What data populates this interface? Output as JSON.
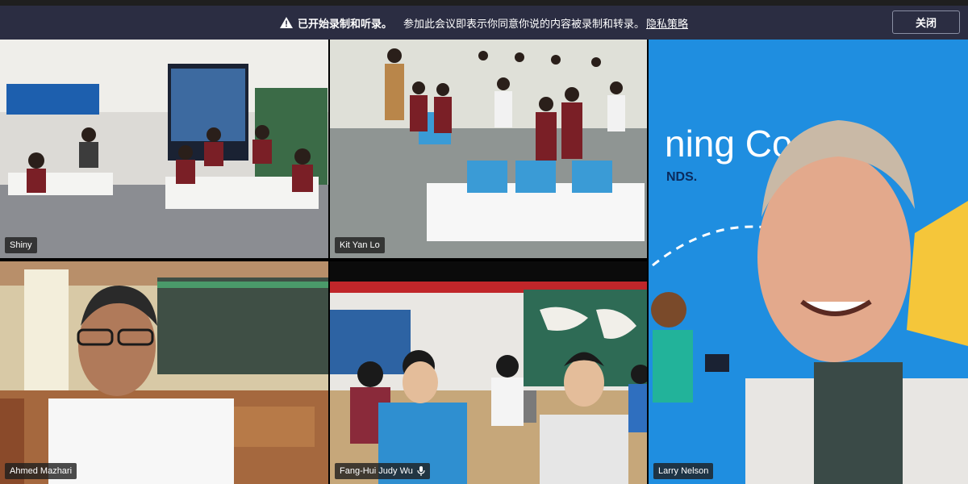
{
  "banner": {
    "title": "已开始录制和听录。",
    "message": "参加此会议即表示你同意你说的内容被录制和转录。",
    "privacy_link": "隐私策略",
    "close_label": "关闭"
  },
  "participants": [
    {
      "name": "Shiny"
    },
    {
      "name": "Kit Yan Lo"
    },
    {
      "name": "Larry Nelson"
    },
    {
      "name": "Ahmed Mazhari"
    },
    {
      "name": "Fang-Hui Judy Wu"
    }
  ],
  "scene_text": {
    "backdrop_words": "ning Co     tion",
    "backdrop_sub": "NDS."
  },
  "icons": [
    "warning-icon",
    "mic-icon"
  ],
  "colors": {
    "banner_bg": "#2b2d42",
    "larry_backdrop": "#1f8ee0"
  }
}
